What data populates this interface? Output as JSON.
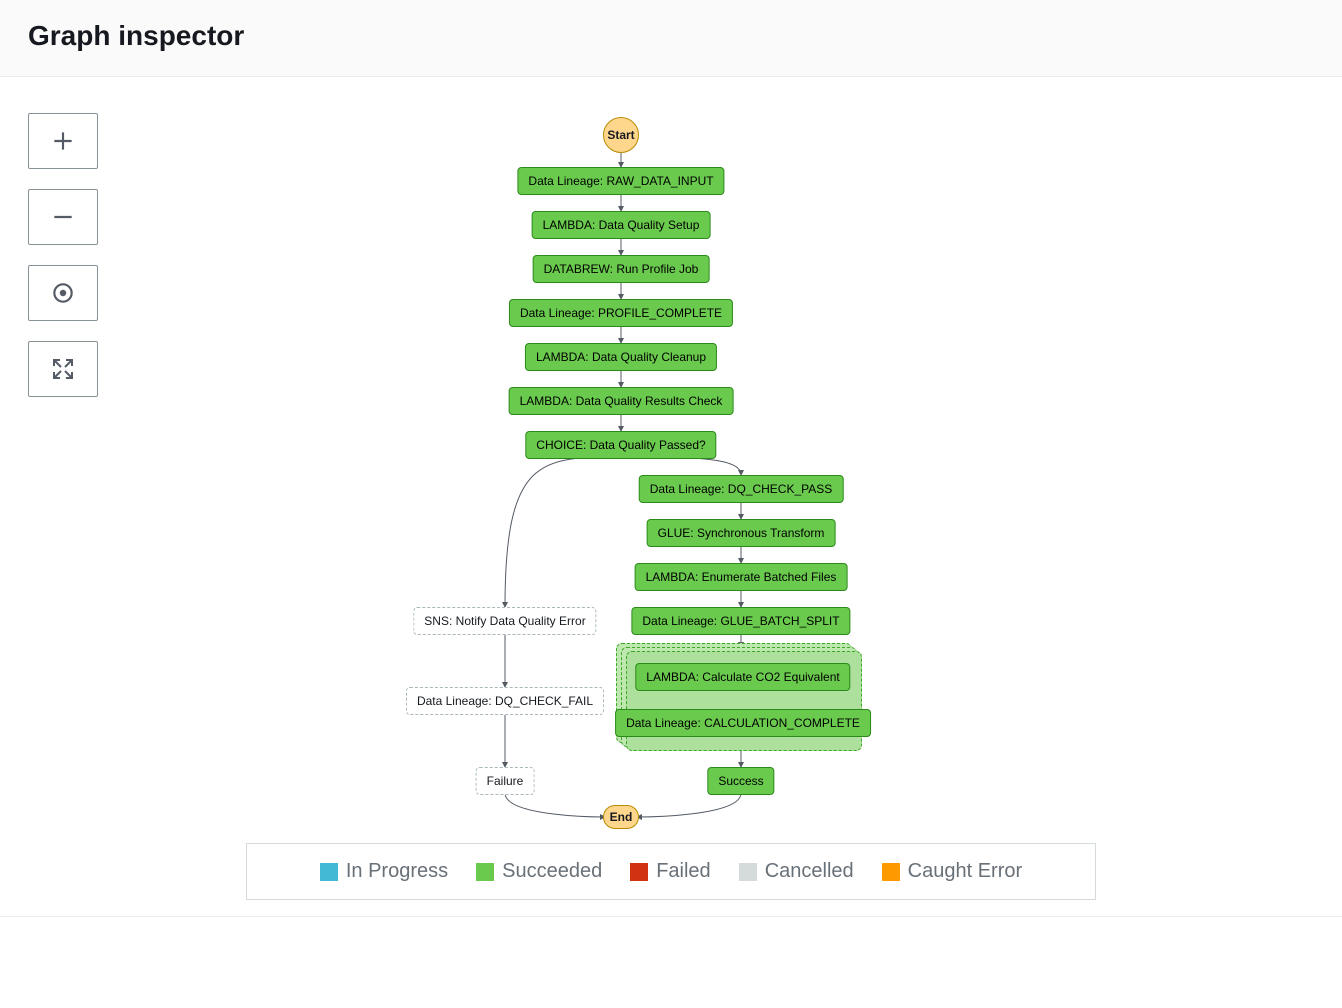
{
  "header": {
    "title": "Graph inspector"
  },
  "controls": {
    "zoom_in": "Zoom in",
    "zoom_out": "Zoom out",
    "center": "Center",
    "fullscreen": "Full screen"
  },
  "graph": {
    "start_label": "Start",
    "end_label": "End",
    "nodes": {
      "raw_input": {
        "label": "Data Lineage: RAW_DATA_INPUT",
        "status": "succeeded"
      },
      "dq_setup": {
        "label": "LAMBDA: Data Quality Setup",
        "status": "succeeded"
      },
      "profile_job": {
        "label": "DATABREW: Run Profile Job",
        "status": "succeeded"
      },
      "profile_complete": {
        "label": "Data Lineage: PROFILE_COMPLETE",
        "status": "succeeded"
      },
      "dq_cleanup": {
        "label": "LAMBDA: Data Quality Cleanup",
        "status": "succeeded"
      },
      "dq_results": {
        "label": "LAMBDA: Data Quality Results Check",
        "status": "succeeded"
      },
      "choice": {
        "label": "CHOICE: Data Quality Passed?",
        "status": "succeeded"
      },
      "dq_pass": {
        "label": "Data Lineage: DQ_CHECK_PASS",
        "status": "succeeded"
      },
      "glue_transform": {
        "label": "GLUE: Synchronous Transform",
        "status": "succeeded"
      },
      "enum_batched": {
        "label": "LAMBDA: Enumerate Batched Files",
        "status": "succeeded"
      },
      "batch_split": {
        "label": "Data Lineage: GLUE_BATCH_SPLIT",
        "status": "succeeded"
      },
      "calc_co2": {
        "label": "LAMBDA: Calculate CO2 Equivalent",
        "status": "succeeded"
      },
      "calc_complete": {
        "label": "Data Lineage: CALCULATION_COMPLETE",
        "status": "succeeded"
      },
      "success": {
        "label": "Success",
        "status": "succeeded"
      },
      "sns_error": {
        "label": "SNS: Notify Data Quality Error",
        "status": "not_run"
      },
      "dq_fail": {
        "label": "Data Lineage: DQ_CHECK_FAIL",
        "status": "not_run"
      },
      "failure": {
        "label": "Failure",
        "status": "not_run"
      }
    },
    "edges": [
      [
        "start",
        "raw_input"
      ],
      [
        "raw_input",
        "dq_setup"
      ],
      [
        "dq_setup",
        "profile_job"
      ],
      [
        "profile_job",
        "profile_complete"
      ],
      [
        "profile_complete",
        "dq_cleanup"
      ],
      [
        "dq_cleanup",
        "dq_results"
      ],
      [
        "dq_results",
        "choice"
      ],
      [
        "choice",
        "dq_pass"
      ],
      [
        "choice",
        "sns_error"
      ],
      [
        "dq_pass",
        "glue_transform"
      ],
      [
        "glue_transform",
        "enum_batched"
      ],
      [
        "enum_batched",
        "batch_split"
      ],
      [
        "batch_split",
        "map"
      ],
      [
        "calc_co2",
        "calc_complete"
      ],
      [
        "map",
        "success"
      ],
      [
        "sns_error",
        "dq_fail"
      ],
      [
        "dq_fail",
        "failure"
      ],
      [
        "failure",
        "end"
      ],
      [
        "success",
        "end"
      ]
    ]
  },
  "legend": {
    "in_progress": "In Progress",
    "succeeded": "Succeeded",
    "failed": "Failed",
    "cancelled": "Cancelled",
    "caught": "Caught Error"
  },
  "colors": {
    "succeeded": "#6aca4d",
    "in_progress": "#44b9d6",
    "failed": "#d13212",
    "cancelled": "#d5dbdb",
    "caught": "#ff9900",
    "start_end": "#ffd78c"
  }
}
